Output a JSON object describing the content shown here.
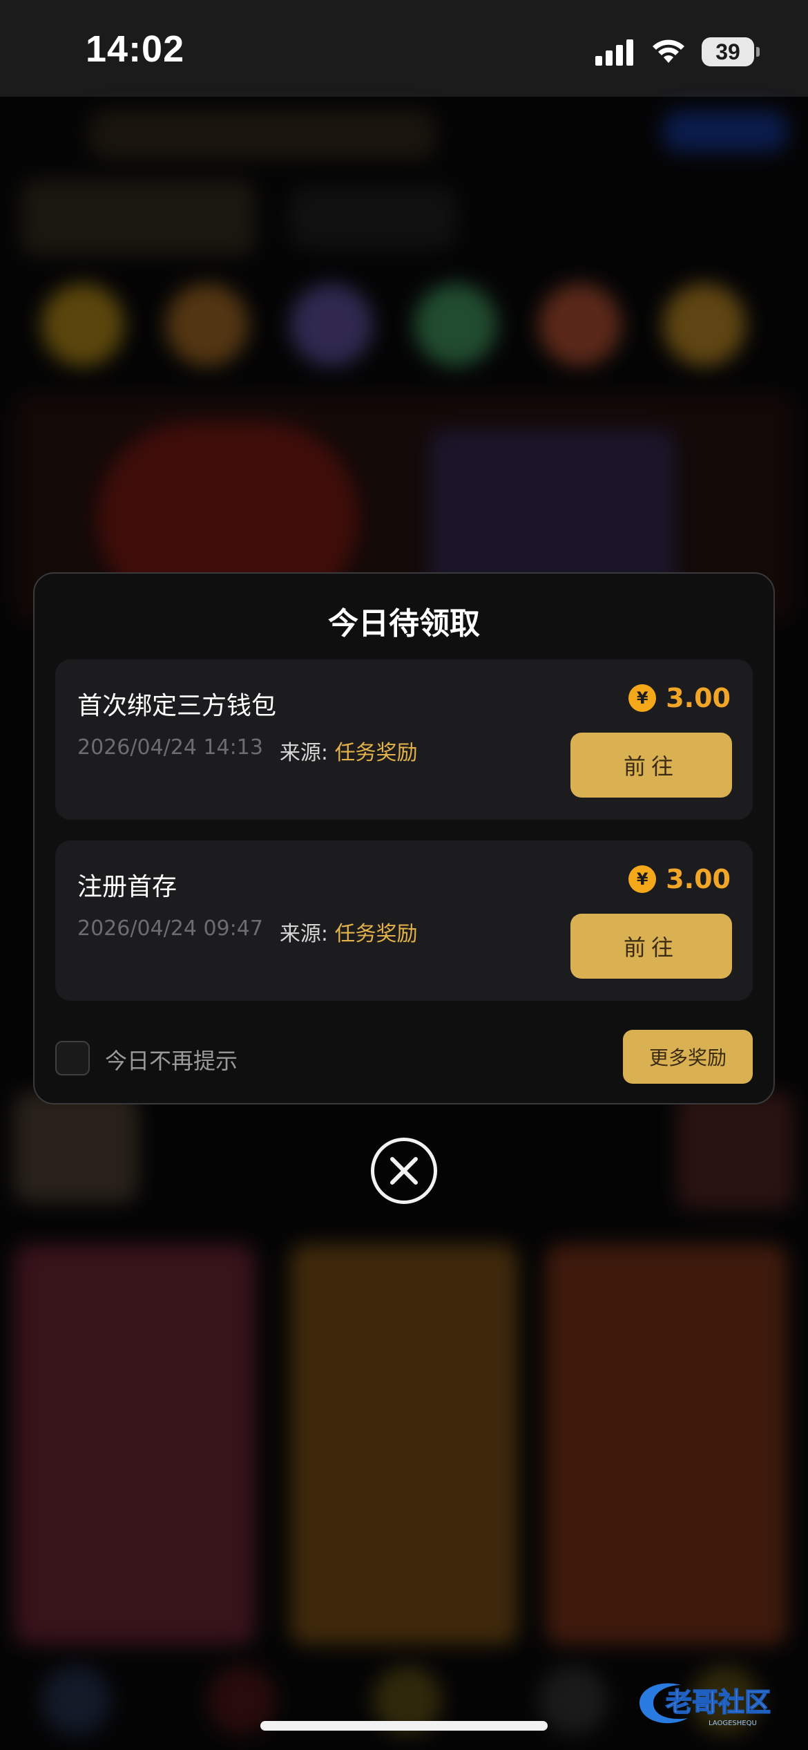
{
  "status_bar": {
    "time": "14:02",
    "battery": "39",
    "icons": [
      "signal-icon",
      "wifi-icon",
      "battery-icon"
    ]
  },
  "modal": {
    "title": "今日待领取",
    "rewards": [
      {
        "title": "首次绑定三方钱包",
        "datetime": "2026/04/24 14:13",
        "source_label": "来源:",
        "source_value": "任务奖励",
        "currency_symbol": "¥",
        "amount": "3.00",
        "button_label": "前往"
      },
      {
        "title": "注册首存",
        "datetime": "2026/04/24 09:47",
        "source_label": "来源:",
        "source_value": "任务奖励",
        "currency_symbol": "¥",
        "amount": "3.00",
        "button_label": "前往"
      }
    ],
    "dont_show_today_label": "今日不再提示",
    "more_rewards_label": "更多奖励"
  },
  "watermark": {
    "text": "老哥社区",
    "subtext": "LAOGESHEQU"
  },
  "colors": {
    "accent_gold": "#d9b052",
    "amount_orange": "#f2a628",
    "source_gold": "#e3b24a",
    "modal_bg": "#0f0f10",
    "card_bg": "#1c1c1e"
  }
}
